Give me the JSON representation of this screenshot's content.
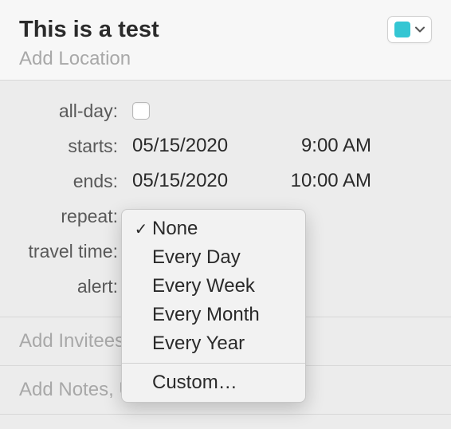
{
  "header": {
    "title": "This is a test",
    "location_placeholder": "Add Location",
    "calendar_color": "#34c6d3"
  },
  "fields": {
    "all_day_label": "all-day:",
    "all_day_checked": false,
    "starts_label": "starts:",
    "starts_date": "05/15/2020",
    "starts_time": "9:00 AM",
    "ends_label": "ends:",
    "ends_date": "05/15/2020",
    "ends_time": "10:00 AM",
    "repeat_label": "repeat:",
    "travel_time_label": "travel time:",
    "alert_label": "alert:"
  },
  "sections": {
    "invitees": "Add Invitees",
    "notes": "Add Notes, URL, or Attachments"
  },
  "repeat_menu": {
    "selected": "None",
    "items": [
      "None",
      "Every Day",
      "Every Week",
      "Every Month",
      "Every Year"
    ],
    "custom": "Custom…"
  }
}
